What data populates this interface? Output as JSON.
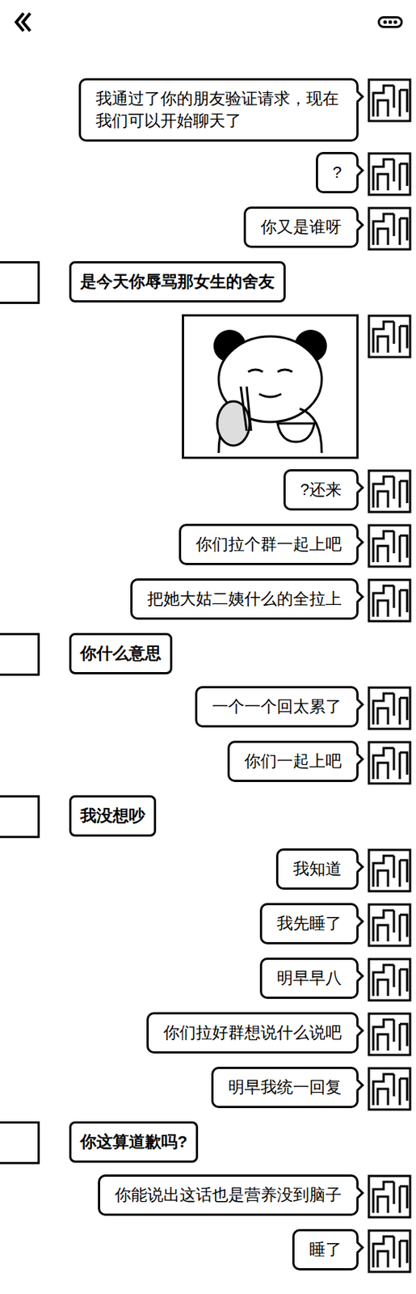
{
  "messages": [
    {
      "side": "right",
      "kind": "text",
      "text": "我通过了你的朋友验证请求，现在我们可以开始聊天了"
    },
    {
      "side": "right",
      "kind": "text",
      "text": "?"
    },
    {
      "side": "right",
      "kind": "text",
      "text": "你又是谁呀"
    },
    {
      "side": "left",
      "kind": "text",
      "text": "是今天你辱骂那女生的舍友"
    },
    {
      "side": "right",
      "kind": "sticker",
      "text": ""
    },
    {
      "side": "right",
      "kind": "text",
      "text": "?还来"
    },
    {
      "side": "right",
      "kind": "text",
      "text": "你们拉个群一起上吧"
    },
    {
      "side": "right",
      "kind": "text",
      "text": "把她大姑二姨什么的全拉上"
    },
    {
      "side": "left",
      "kind": "text",
      "text": "你什么意思"
    },
    {
      "side": "right",
      "kind": "text",
      "text": "一个一个回太累了"
    },
    {
      "side": "right",
      "kind": "text",
      "text": "你们一起上吧"
    },
    {
      "side": "left",
      "kind": "text",
      "text": "我没想吵"
    },
    {
      "side": "right",
      "kind": "text",
      "text": "我知道"
    },
    {
      "side": "right",
      "kind": "text",
      "text": "我先睡了"
    },
    {
      "side": "right",
      "kind": "text",
      "text": "明早早八"
    },
    {
      "side": "right",
      "kind": "text",
      "text": "你们拉好群想说什么说吧"
    },
    {
      "side": "right",
      "kind": "text",
      "text": "明早我统一回复"
    },
    {
      "side": "left",
      "kind": "text",
      "text": "你这算道歉吗?"
    },
    {
      "side": "right",
      "kind": "text",
      "text": "你能说出这话也是营养没到脑子"
    },
    {
      "side": "right",
      "kind": "text",
      "text": "睡了"
    }
  ]
}
